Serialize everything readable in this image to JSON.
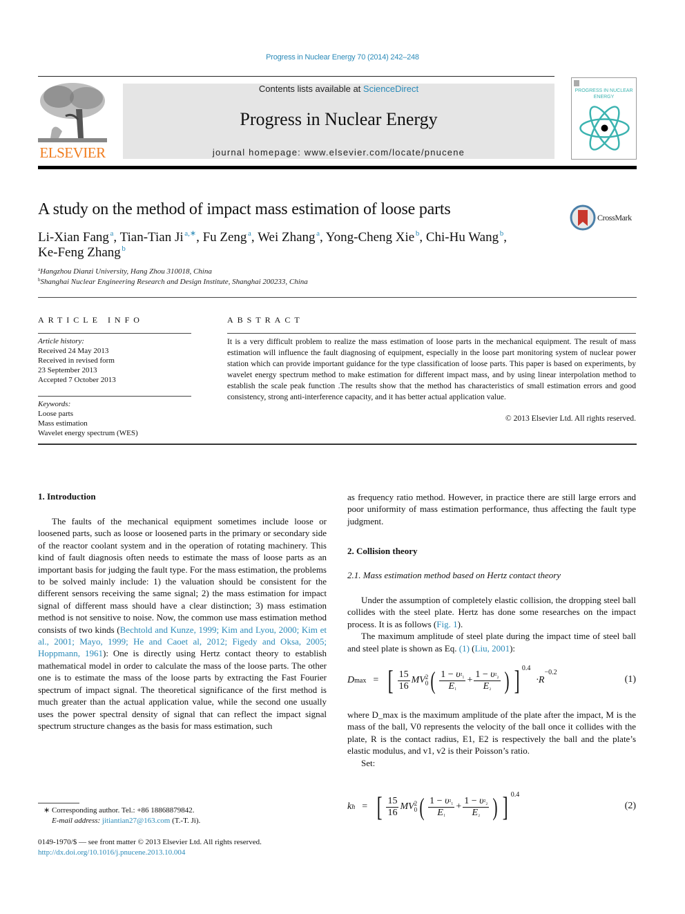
{
  "header": {
    "journal_ref": "Progress in Nuclear Energy 70 (2014) 242–248",
    "contents_prefix": "Contents lists available at ",
    "contents_link": "ScienceDirect",
    "journal_title": "Progress in Nuclear Energy",
    "homepage": "journal homepage: www.elsevier.com/locate/pnucene",
    "publisher_logo": "ELSEVIER",
    "cover_title": "PROGRESS IN NUCLEAR ENERGY",
    "cover_icon": "atom-icon",
    "crossmark_label": "CrossMark"
  },
  "article": {
    "title": "A study on the method of impact mass estimation of loose parts",
    "authors": [
      {
        "name": "Li-Xian Fang",
        "aff": "a"
      },
      {
        "name": "Tian-Tian Ji",
        "aff": "a,∗"
      },
      {
        "name": "Fu Zeng",
        "aff": "a"
      },
      {
        "name": "Wei Zhang",
        "aff": "a"
      },
      {
        "name": "Yong-Cheng Xie",
        "aff": "b"
      },
      {
        "name": "Chi-Hu Wang",
        "aff": "b"
      },
      {
        "name": "Ke-Feng Zhang",
        "aff": "b"
      }
    ],
    "affiliations": [
      {
        "key": "a",
        "text": "Hangzhou Dianzi University, Hang Zhou 310018, China"
      },
      {
        "key": "b",
        "text": "Shanghai Nuclear Engineering Research and Design Institute, Shanghai 200233, China"
      }
    ]
  },
  "article_info": {
    "heading": "ARTICLE INFO",
    "history_label": "Article history:",
    "history": [
      "Received 24 May 2013",
      "Received in revised form",
      "23 September 2013",
      "Accepted 7 October 2013"
    ],
    "keywords_label": "Keywords:",
    "keywords": [
      "Loose parts",
      "Mass estimation",
      "Wavelet energy spectrum (WES)"
    ]
  },
  "abstract": {
    "heading": "ABSTRACT",
    "text": "It is a very difficult problem to realize the mass estimation of loose parts in the mechanical equipment. The result of mass estimation will influence the fault diagnosing of equipment, especially in the loose part monitoring system of nuclear power station which can provide important guidance for the type classification of loose parts. This paper is based on experiments, by wavelet energy spectrum method to make estimation for different impact mass, and by using linear interpolation method to establish the scale peak function .The results show that the method has characteristics of small estimation errors and good consistency, strong anti-interference capacity, and it has better actual application value.",
    "copyright": "© 2013 Elsevier Ltd. All rights reserved."
  },
  "body": {
    "section1_heading": "1.  Introduction",
    "intro_p1_a": "The faults of the mechanical equipment sometimes include loose or loosened parts, such as loose or loosened parts in the primary or secondary side of the reactor coolant system and in the operation of rotating machinery. This kind of fault diagnosis often needs to estimate the mass of loose parts as an important basis for judging the fault type. For the mass estimation, the problems to be solved mainly include: 1) the valuation should be consistent for the different sensors receiving the same signal; 2) the mass estimation for impact signal of different mass should have a clear distinction; 3) mass estimation method is not sensitive to noise. Now, the common use mass estimation method consists of two kinds (",
    "intro_citations": "Bechtold and Kunze, 1999; Kim and Lyou, 2000; Kim et al., 2001; Mayo, 1999; He and Caoet al, 2012; Figedy and Oksa, 2005; Hoppmann, 1961",
    "intro_p1_b": "): One is directly using Hertz contact theory to establish mathematical model in order to calculate the mass of the loose parts. The other one is to estimate the mass of the loose parts by extracting the Fast Fourier spectrum of impact signal. The theoretical significance of the first method is much greater than the actual application value, while the second one usually uses the power spectral density of signal that can reflect the impact signal spectrum structure changes as the basis for mass estimation, such",
    "right_p1": "as frequency ratio method. However, in practice there are still large errors and poor uniformity of mass estimation performance, thus affecting the fault type judgment.",
    "section2_heading": "2.  Collision theory",
    "subsection21_heading": "2.1.  Mass estimation method based on Hertz contact theory",
    "hertz_p1_a": "Under the assumption of completely elastic collision, the dropping steel ball collides with the steel plate. Hertz has done some researches on the impact process. It is as follows (",
    "fig_ref": "Fig. 1",
    "hertz_p1_b": ").",
    "hertz_p2_a": "The maximum amplitude of steel plate during the impact time of steel ball and steel plate is shown as Eq. ",
    "eq_ref": "(1)",
    "hertz_p2_mid": " (",
    "liu_ref": "Liu, 2001",
    "hertz_p2_b": "):",
    "eq1_lhs": "D",
    "eq1_lhs_sub": "max",
    "eq1_number": "(1)",
    "eq1_outer_exp": "0.4",
    "eq1_tail": "·R",
    "eq1_tail_exp": "−0.2",
    "eq2_lhs": "k",
    "eq2_lhs_sub": "h",
    "eq2_number": "(2)",
    "eq2_outer_exp": "0.4",
    "where_text": "where D_max is the maximum amplitude of the plate after the impact, M is the mass of the ball, V0 represents the velocity of the ball once it collides with the plate, R is the contact radius, E1, E2 is respectively the ball and the plate’s elastic modulus, and v1, v2 is their Poisson’s ratio.",
    "set_label": "Set:"
  },
  "footnotes": {
    "corresponding": "∗ Corresponding author. Tel.: +86 18868879842.",
    "email_label": "E-mail address: ",
    "email": "jitiantian27@163.com",
    "email_suffix": " (T.-T. Ji).",
    "front_matter": "0149-1970/$ — see front matter © 2013 Elsevier Ltd. All rights reserved.",
    "doi": "http://dx.doi.org/10.1016/j.pnucene.2013.10.004"
  },
  "colors": {
    "link": "#2a8ab8",
    "elsevier_orange": "#f07c1d",
    "banner_gray": "#e5e5e5",
    "cover_teal": "#3bb3b0"
  }
}
